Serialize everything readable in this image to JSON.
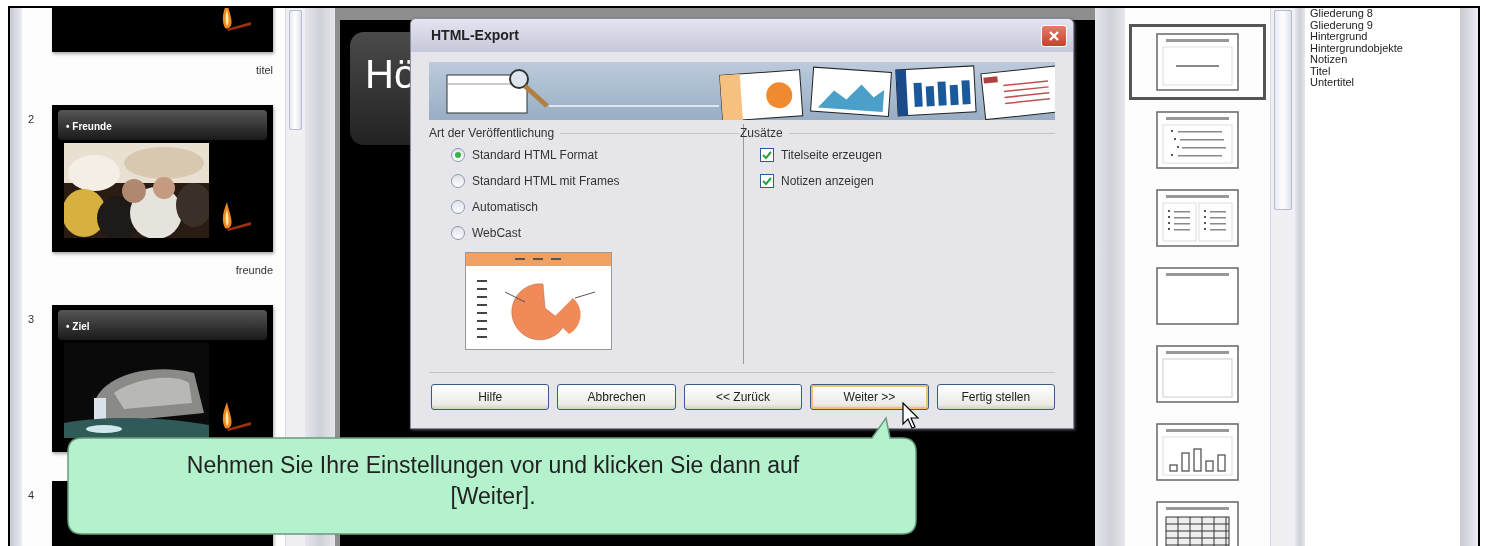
{
  "slides_panel": {
    "slides": [
      {
        "kind": "title",
        "label": "titel"
      },
      {
        "number": "2",
        "heading": "• Freunde",
        "label": "freunde"
      },
      {
        "number": "3",
        "heading": "• Ziel"
      },
      {
        "number": "4"
      }
    ]
  },
  "slide": {
    "title": "Hö"
  },
  "dialog": {
    "title": "HTML-Export",
    "publication": {
      "heading": "Art der Veröffentlichung",
      "options": [
        {
          "label": "Standard HTML Format",
          "selected": true
        },
        {
          "label": "Standard HTML mit Frames",
          "selected": false
        },
        {
          "label": "Automatisch",
          "selected": false
        },
        {
          "label": "WebCast",
          "selected": false
        }
      ]
    },
    "extras": {
      "heading": "Zusätze",
      "options": [
        {
          "label": "Titelseite erzeugen",
          "checked": true
        },
        {
          "label": "Notizen anzeigen",
          "checked": true
        }
      ]
    },
    "buttons": [
      {
        "label": "Hilfe",
        "default": false
      },
      {
        "label": "Abbrechen",
        "default": false
      },
      {
        "label": "<< Zurück",
        "default": false
      },
      {
        "label": "Weiter >>",
        "default": true
      },
      {
        "label": "Fertig stellen",
        "default": false
      }
    ]
  },
  "layouts": {
    "items": [
      {
        "kind": "title-subtitle",
        "selected": true
      },
      {
        "kind": "title-list",
        "selected": false
      },
      {
        "kind": "title-two-lists",
        "selected": false
      },
      {
        "kind": "title-only",
        "selected": false
      },
      {
        "kind": "title-content",
        "selected": false
      },
      {
        "kind": "title-chart",
        "selected": false
      },
      {
        "kind": "title-table",
        "selected": false
      }
    ]
  },
  "styles": {
    "items": [
      "Gliederung 8",
      "Gliederung 9",
      "Hintergrund",
      "Hintergrundobjekte",
      "Notizen",
      "Titel",
      "Untertitel"
    ]
  },
  "callout": {
    "text": "Nehmen Sie Ihre Einstellungen vor und klicken Sie dann auf [Weiter]."
  }
}
